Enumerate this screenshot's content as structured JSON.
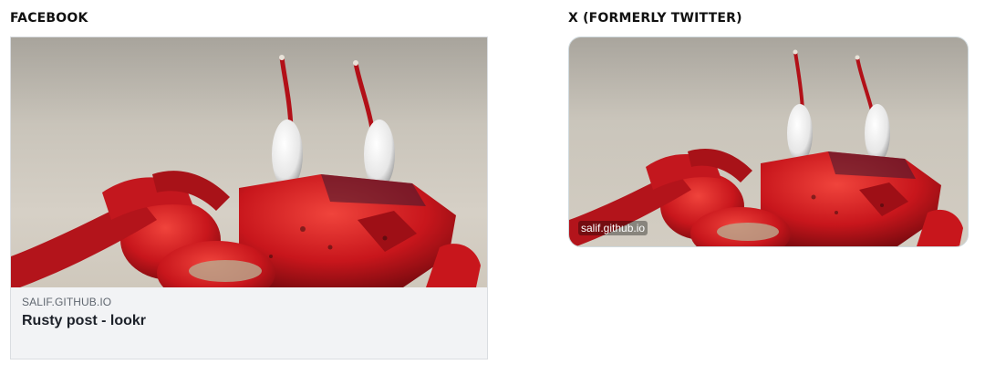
{
  "facebook": {
    "section_title": "FACEBOOK",
    "domain": "SALIF.GITHUB.IO",
    "headline": "Rusty post - lookr",
    "image_icon": "crab-photo"
  },
  "x": {
    "section_title": "X (FORMERLY TWITTER)",
    "domain": "salif.github.io",
    "image_icon": "crab-photo"
  },
  "colors": {
    "fb_card_background": "#f2f3f5",
    "fb_border": "#dadde1",
    "x_border": "#cfd9de",
    "crab_red": "#c8161c",
    "sand": "#cfc9bf"
  }
}
